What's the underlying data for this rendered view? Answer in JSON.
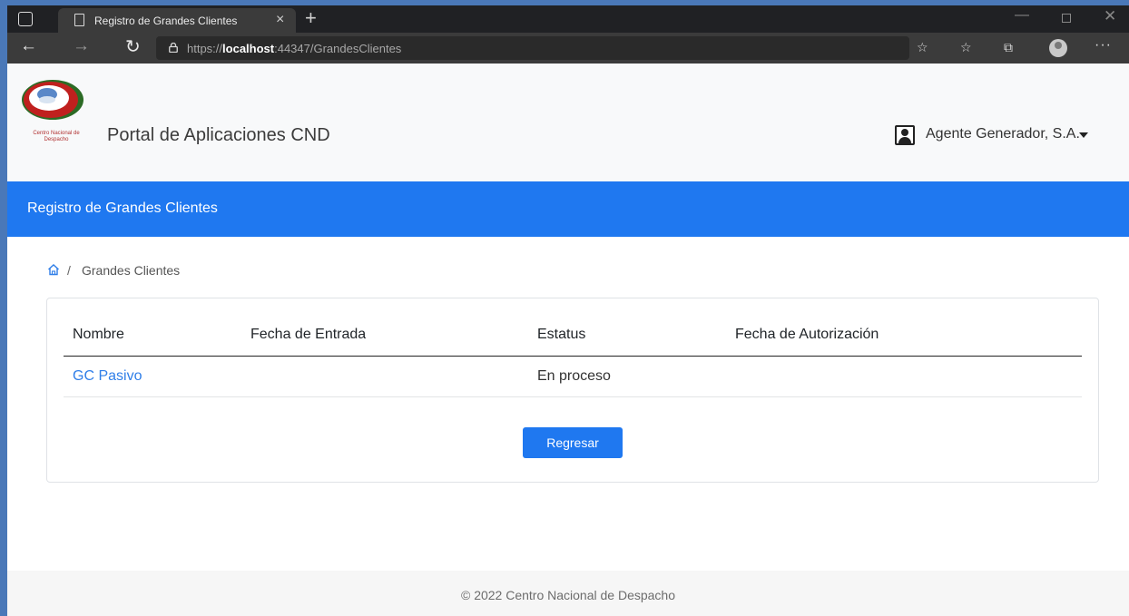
{
  "browser": {
    "tab_title": "Registro de Grandes Clientes",
    "tab_close": "×",
    "new_tab": "+",
    "url_scheme": "https://",
    "url_host": "localhost",
    "url_rest": ":44347/GrandesClientes",
    "more": "···"
  },
  "header": {
    "brand": "Portal de Aplicaciones CND",
    "logo_caption": "Centro Nacional de Despacho",
    "user_name": "Agente Generador, S.A."
  },
  "banner": {
    "title": "Registro de Grandes Clientes"
  },
  "breadcrumb": {
    "separator": "/",
    "current": "Grandes Clientes"
  },
  "table": {
    "columns": [
      "Nombre",
      "Fecha de Entrada",
      "Estatus",
      "Fecha de Autorización"
    ],
    "rows": [
      {
        "nombre": "GC Pasivo",
        "fecha_entrada": "",
        "estatus": "En proceso",
        "fecha_autorizacion": ""
      }
    ]
  },
  "actions": {
    "back_label": "Regresar"
  },
  "footer": {
    "text": "© 2022 Centro Nacional de Despacho"
  }
}
